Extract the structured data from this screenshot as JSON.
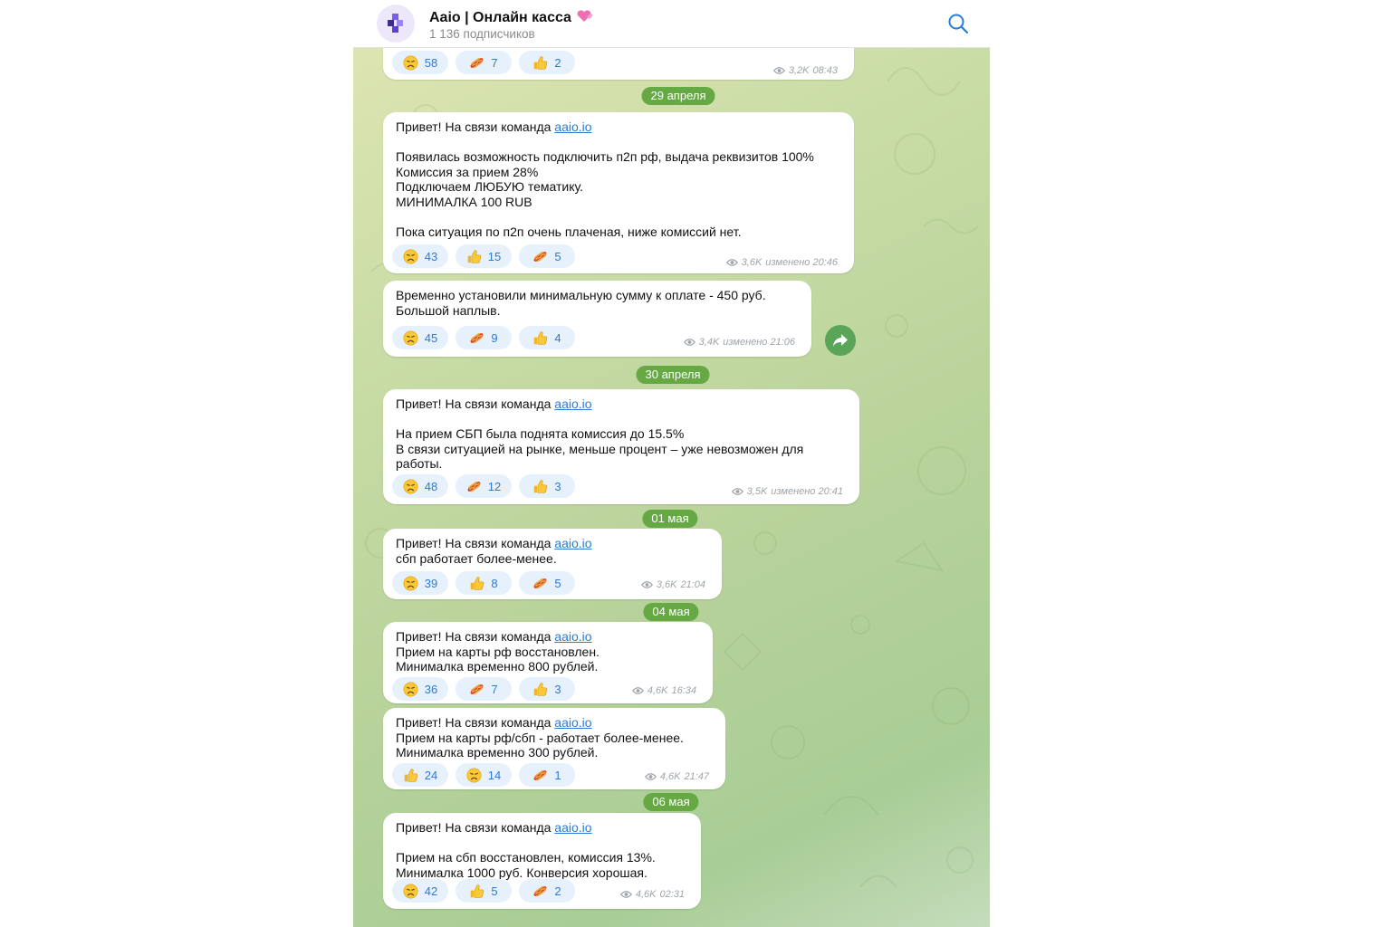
{
  "channel": {
    "title": "Aaio | Онлайн касса",
    "subscribers": "1 136 подписчиков"
  },
  "colors": {
    "link": "#2a7bd6",
    "reaction_bg": "#e7f1fb",
    "date_pill": "#66a844",
    "share_button": "#5aa55a"
  },
  "icons": {
    "avatar": "aaio-logo",
    "title_emoji": "hearts-emoji",
    "search": "search-icon",
    "views": "eye-icon",
    "share": "share-arrow-icon",
    "reactions": {
      "sad": "sad-face-emoji",
      "hotdog": "hotdog-emoji",
      "thumb": "thumbs-up-emoji"
    }
  },
  "dates": [
    "29 апреля",
    "30 апреля",
    "01 мая",
    "04 мая",
    "06 мая"
  ],
  "messages": [
    {
      "lines": [],
      "reactions": [
        {
          "emoji": "sad",
          "count": "58"
        },
        {
          "emoji": "hotdog",
          "count": "7"
        },
        {
          "emoji": "thumb",
          "count": "2"
        }
      ],
      "views": "3,2K",
      "time": "08:43"
    },
    {
      "lines": [
        {
          "before": "Привет! На связи команда ",
          "link": "aaio.io"
        },
        {
          "text": ""
        },
        {
          "text": "Появилась возможность подключить п2п рф, выдача реквизитов 100%"
        },
        {
          "text": "Комиссия за прием 28%"
        },
        {
          "text": "Подключаем ЛЮБУЮ тематику."
        },
        {
          "text": "МИНИМАЛКА 100 RUB"
        },
        {
          "text": ""
        },
        {
          "text": "Пока ситуация по п2п очень плаченая, ниже комиссий нет."
        }
      ],
      "reactions": [
        {
          "emoji": "sad",
          "count": "43"
        },
        {
          "emoji": "thumb",
          "count": "15"
        },
        {
          "emoji": "hotdog",
          "count": "5"
        }
      ],
      "views": "3,6K",
      "time": "изменено 20:46"
    },
    {
      "lines": [
        {
          "text": "Временно установили минимальную сумму к оплате - 450 руб."
        },
        {
          "text": "Большой наплыв."
        }
      ],
      "reactions": [
        {
          "emoji": "sad",
          "count": "45"
        },
        {
          "emoji": "hotdog",
          "count": "9"
        },
        {
          "emoji": "thumb",
          "count": "4"
        }
      ],
      "views": "3,4K",
      "time": "изменено 21:06"
    },
    {
      "lines": [
        {
          "before": "Привет! На связи команда ",
          "link": "aaio.io"
        },
        {
          "text": ""
        },
        {
          "text": "На прием СБП была поднята комиссия до 15.5%"
        },
        {
          "text": "В связи ситуацией на рынке, меньше процент – уже невозможен для"
        },
        {
          "text": "работы."
        }
      ],
      "reactions": [
        {
          "emoji": "sad",
          "count": "48"
        },
        {
          "emoji": "hotdog",
          "count": "12"
        },
        {
          "emoji": "thumb",
          "count": "3"
        }
      ],
      "views": "3,5K",
      "time": "изменено 20:41"
    },
    {
      "lines": [
        {
          "before": "Привет! На связи команда ",
          "link": "aaio.io"
        },
        {
          "text": "сбп работает более-менее."
        }
      ],
      "reactions": [
        {
          "emoji": "sad",
          "count": "39"
        },
        {
          "emoji": "thumb",
          "count": "8"
        },
        {
          "emoji": "hotdog",
          "count": "5"
        }
      ],
      "views": "3,6K",
      "time": "21:04"
    },
    {
      "lines": [
        {
          "before": "Привет! На связи команда ",
          "link": "aaio.io"
        },
        {
          "text": "Прием на карты рф восстановлен."
        },
        {
          "text": "Минималка временно 800 рублей."
        }
      ],
      "reactions": [
        {
          "emoji": "sad",
          "count": "36"
        },
        {
          "emoji": "hotdog",
          "count": "7"
        },
        {
          "emoji": "thumb",
          "count": "3"
        }
      ],
      "views": "4,6K",
      "time": "16:34"
    },
    {
      "lines": [
        {
          "before": "Привет! На связи команда ",
          "link": "aaio.io"
        },
        {
          "text": "Прием на карты рф/сбп - работает более-менее."
        },
        {
          "text": "Минималка временно 300 рублей."
        }
      ],
      "reactions": [
        {
          "emoji": "thumb",
          "count": "24"
        },
        {
          "emoji": "sad",
          "count": "14"
        },
        {
          "emoji": "hotdog",
          "count": "1"
        }
      ],
      "views": "4,6K",
      "time": "21:47"
    },
    {
      "lines": [
        {
          "before": "Привет! На связи команда ",
          "link": "aaio.io"
        },
        {
          "text": ""
        },
        {
          "text": "Прием на сбп восстановлен, комиссия 13%."
        },
        {
          "text": "Минималка 1000 руб. Конверсия хорошая."
        }
      ],
      "reactions": [
        {
          "emoji": "sad",
          "count": "42"
        },
        {
          "emoji": "thumb",
          "count": "5"
        },
        {
          "emoji": "hotdog",
          "count": "2"
        }
      ],
      "views": "4,6K",
      "time": "02:31"
    }
  ]
}
